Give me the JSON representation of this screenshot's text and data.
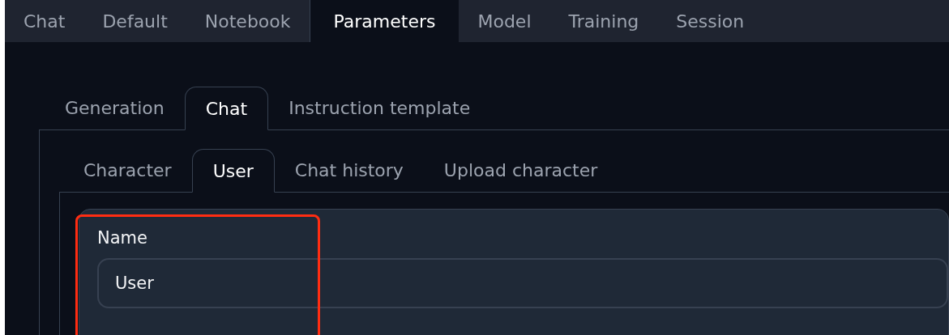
{
  "main_tabs": [
    {
      "label": "Chat",
      "selected": false
    },
    {
      "label": "Default",
      "selected": false
    },
    {
      "label": "Notebook",
      "selected": false
    },
    {
      "label": "Parameters",
      "selected": true
    },
    {
      "label": "Model",
      "selected": false
    },
    {
      "label": "Training",
      "selected": false
    },
    {
      "label": "Session",
      "selected": false
    }
  ],
  "sub_tabs": [
    {
      "label": "Generation",
      "selected": false
    },
    {
      "label": "Chat",
      "selected": true
    },
    {
      "label": "Instruction template",
      "selected": false
    }
  ],
  "chat_tabs": [
    {
      "label": "Character",
      "selected": false
    },
    {
      "label": "User",
      "selected": true
    },
    {
      "label": "Chat history",
      "selected": false
    },
    {
      "label": "Upload character",
      "selected": false
    }
  ],
  "name_field": {
    "label": "Name",
    "value": "User"
  }
}
